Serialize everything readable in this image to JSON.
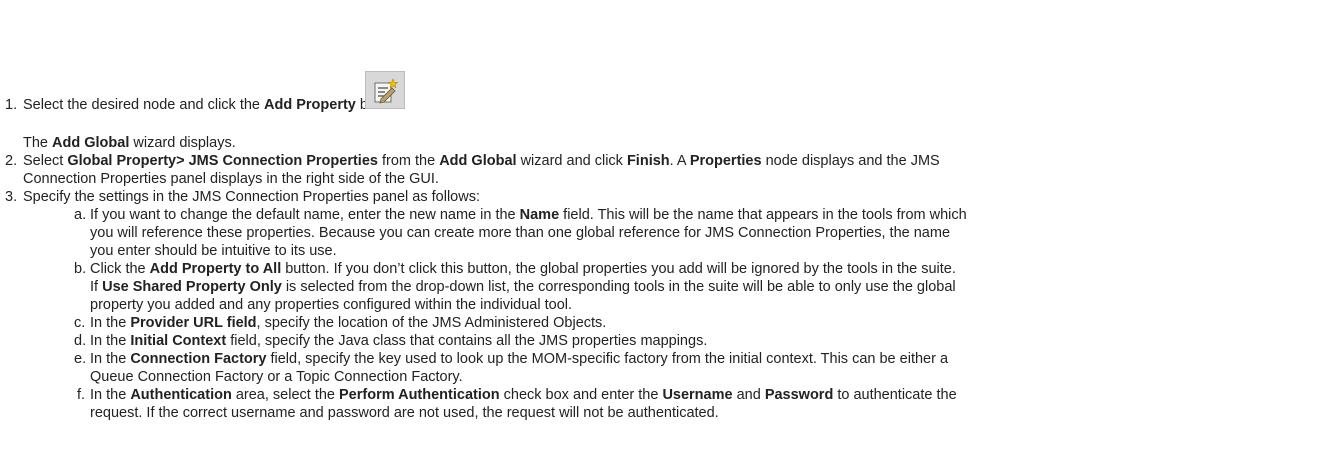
{
  "steps": [
    {
      "number": "1.",
      "segments": [
        {
          "text": "Select the desired node and click the ",
          "bold": false
        },
        {
          "text": "Add Property",
          "bold": true
        },
        {
          "text": " button.",
          "bold": false
        }
      ],
      "note": [
        {
          "text": "The ",
          "bold": false
        },
        {
          "text": "Add Global",
          "bold": true
        },
        {
          "text": " wizard displays.",
          "bold": false
        }
      ]
    },
    {
      "number": "2.",
      "lines": [
        [
          {
            "text": "Select ",
            "bold": false
          },
          {
            "text": "Global Property> JMS Connection Properties",
            "bold": true
          },
          {
            "text": " from the ",
            "bold": false
          },
          {
            "text": "Add Global",
            "bold": true
          },
          {
            "text": " wizard and click ",
            "bold": false
          },
          {
            "text": "Finish",
            "bold": true
          },
          {
            "text": ". A ",
            "bold": false
          },
          {
            "text": "Properties",
            "bold": true
          },
          {
            "text": " node displays and the JMS",
            "bold": false
          }
        ],
        [
          {
            "text": "Connection Properties panel displays in the right side of the GUI.",
            "bold": false
          }
        ]
      ]
    },
    {
      "number": "3.",
      "lines": [
        [
          {
            "text": "Specify the settings in the JMS Connection Properties panel as follows:",
            "bold": false
          }
        ]
      ]
    }
  ],
  "substeps": [
    {
      "letter": "a.",
      "lines": [
        [
          {
            "text": "If you want to change the default name, enter the new name in the ",
            "bold": false
          },
          {
            "text": "Name",
            "bold": true
          },
          {
            "text": " field. This will be the name that appears in the tools from which",
            "bold": false
          }
        ],
        [
          {
            "text": "you will reference these properties. Because you can create more than one global reference for JMS Connection Properties, the name",
            "bold": false
          }
        ],
        [
          {
            "text": "you enter should be intuitive to its use.",
            "bold": false
          }
        ]
      ]
    },
    {
      "letter": "b.",
      "lines": [
        [
          {
            "text": "Click the ",
            "bold": false
          },
          {
            "text": "Add Property to All",
            "bold": true
          },
          {
            "text": " button. If you don’t click this button, the global properties you add will be ignored by the tools in the suite.",
            "bold": false
          }
        ],
        [
          {
            "text": "If ",
            "bold": false
          },
          {
            "text": "Use Shared Property Only",
            "bold": true
          },
          {
            "text": " is selected from the drop-down list, the corresponding tools in the suite will be able to only use the global",
            "bold": false
          }
        ],
        [
          {
            "text": "property you added and any properties configured within the individual tool.",
            "bold": false
          }
        ]
      ]
    },
    {
      "letter": "c.",
      "lines": [
        [
          {
            "text": "In the ",
            "bold": false
          },
          {
            "text": "Provider URL field",
            "bold": true
          },
          {
            "text": ", specify the location of the JMS Administered Objects.",
            "bold": false
          }
        ]
      ]
    },
    {
      "letter": "d.",
      "lines": [
        [
          {
            "text": "In the ",
            "bold": false
          },
          {
            "text": "Initial Context",
            "bold": true
          },
          {
            "text": " field, specify the Java class that contains all the JMS properties mappings.",
            "bold": false
          }
        ]
      ]
    },
    {
      "letter": "e.",
      "lines": [
        [
          {
            "text": "In the ",
            "bold": false
          },
          {
            "text": "Connection Factory",
            "bold": true
          },
          {
            "text": " field, specify the key used to look up the MOM-specific factory from the initial context. This can be either a",
            "bold": false
          }
        ],
        [
          {
            "text": "Queue Connection Factory or a Topic Connection Factory.",
            "bold": false
          }
        ]
      ]
    },
    {
      "letter": "f.",
      "lines": [
        [
          {
            "text": "In the ",
            "bold": false
          },
          {
            "text": "Authentication",
            "bold": true
          },
          {
            "text": " area, select the ",
            "bold": false
          },
          {
            "text": "Perform Authentication",
            "bold": true
          },
          {
            "text": " check box and enter the ",
            "bold": false
          },
          {
            "text": "Username",
            "bold": true
          },
          {
            "text": " and ",
            "bold": false
          },
          {
            "text": "Password",
            "bold": true
          },
          {
            "text": " to authenticate the",
            "bold": false
          }
        ],
        [
          {
            "text": "request. If the correct username and password are not used, the request will not be authenticated.",
            "bold": false
          }
        ]
      ]
    }
  ],
  "icons": {
    "add_property": "add-property-icon"
  }
}
